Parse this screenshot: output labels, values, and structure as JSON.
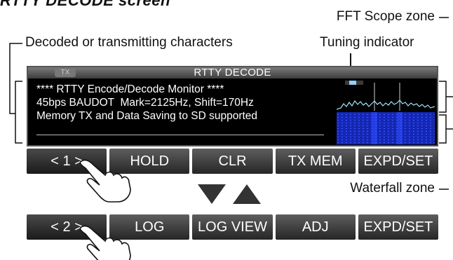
{
  "heading_cut": "RTTY DECODE screen",
  "callouts": {
    "fft_scope_zone": "FFT Scope zone",
    "decoded_chars": "Decoded or transmitting characters",
    "tuning_indicator": "Tuning indicator",
    "waterfall_zone": "Waterfall zone"
  },
  "screen": {
    "title": "RTTY DECODE",
    "tx_badge": "TX",
    "decoded_text": "**** RTTY Encode/Decode Monitor ****\n45bps BAUDOT  Mark=2125Hz, Shift=170Hz\nMemory TX and Data Saving to SD supported"
  },
  "menu1": [
    "< 1 >",
    "HOLD",
    "CLR",
    "TX MEM",
    "EXPD/SET"
  ],
  "menu2": [
    "< 2 >",
    "LOG",
    "LOG VIEW",
    "ADJ",
    "EXPD/SET"
  ],
  "colors": {
    "screen_bg": "#000000",
    "button_top": "#5e5e5e",
    "button_bottom": "#262626",
    "waterfall": "#1a2fd6",
    "trace": "#7fd6ff"
  }
}
